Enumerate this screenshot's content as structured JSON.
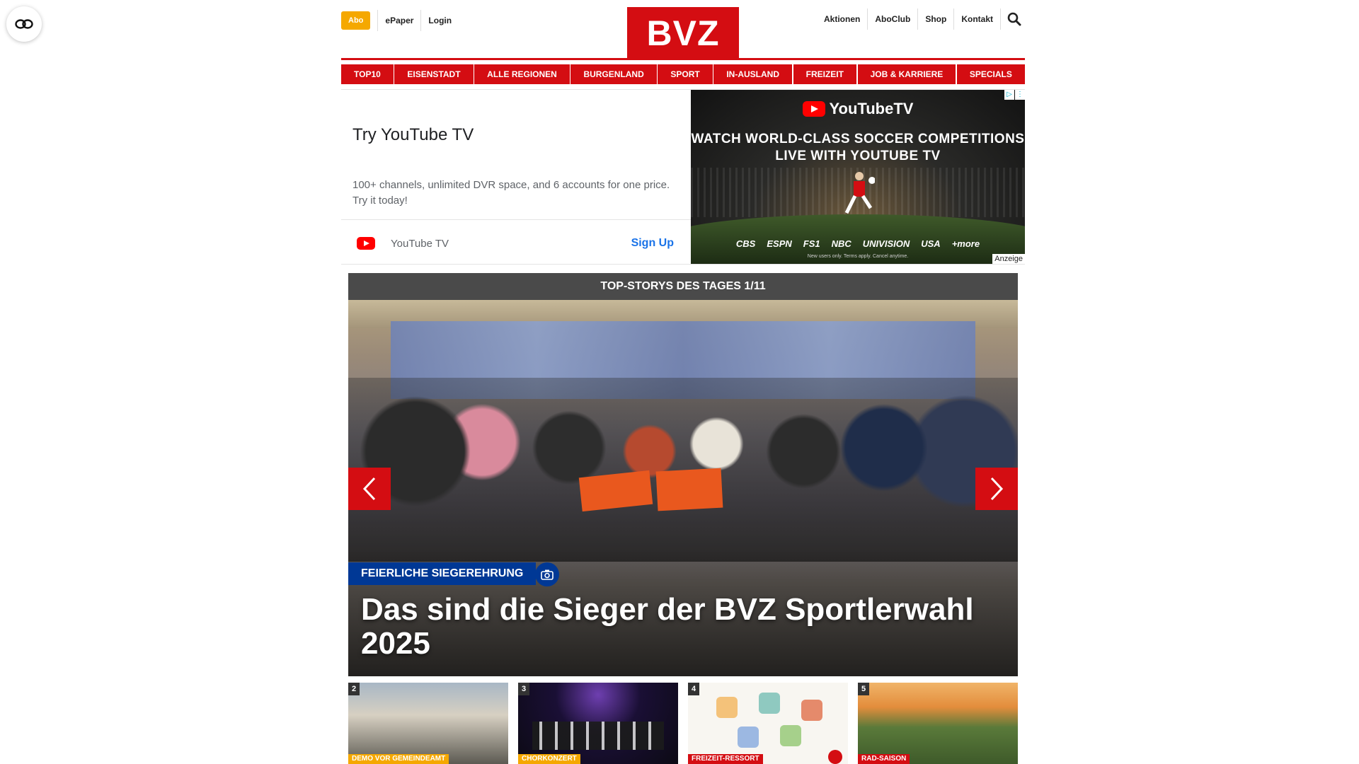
{
  "header": {
    "abo_label": "Abo",
    "epaper_label": "ePaper",
    "login_label": "Login",
    "logo_text": "BVZ",
    "right_links": [
      "Aktionen",
      "AboClub",
      "Shop",
      "Kontakt"
    ]
  },
  "nav": {
    "items": [
      "TOP10",
      "EISENSTADT",
      "ALLE REGIONEN",
      "BURGENLAND",
      "SPORT",
      "IN-AUSLAND",
      "FREIZEIT",
      "JOB & KARRIERE",
      "SPECIALS"
    ]
  },
  "ad": {
    "title": "Try YouTube TV",
    "description": "100+ channels, unlimited DVR space, and 6 accounts for one price. Try it today!",
    "brand": "YouTube TV",
    "cta": "Sign Up",
    "banner_brand": "YouTubeTV",
    "banner_headline": "WATCH WORLD-CLASS SOCCER COMPETITIONS LIVE WITH YOUTUBE TV",
    "networks": [
      "CBS",
      "ESPN",
      "FS1",
      "NBC",
      "UNIVISION",
      "USA",
      "+more"
    ],
    "fine_print": "New users only. Terms apply. Cancel anytime.",
    "anzeige": "Anzeige"
  },
  "stories": {
    "bar_title": "TOP-STORYS DES TAGES 1/11",
    "hero_tag": "FEIERLICHE SIEGEREHRUNG",
    "hero_title": "Das sind die Sieger der BVZ Sportlerwahl 2025",
    "thumbs": [
      {
        "num": "2",
        "label": "DEMO VOR GEMEINDEAMT"
      },
      {
        "num": "3",
        "label": "CHORKONZERT"
      },
      {
        "num": "4",
        "label": "FREIZEIT-RESSORT"
      },
      {
        "num": "5",
        "label": "RAD-SAISON"
      }
    ]
  },
  "colors": {
    "brand_red": "#d40d12",
    "abo_yellow": "#f5a800",
    "tag_blue": "#003895",
    "bar_gray": "#4a4a4a"
  },
  "icons": [
    "accessibility-icon",
    "search-icon",
    "chevron-left-icon",
    "chevron-right-icon",
    "camera-icon",
    "youtube-icon"
  ]
}
